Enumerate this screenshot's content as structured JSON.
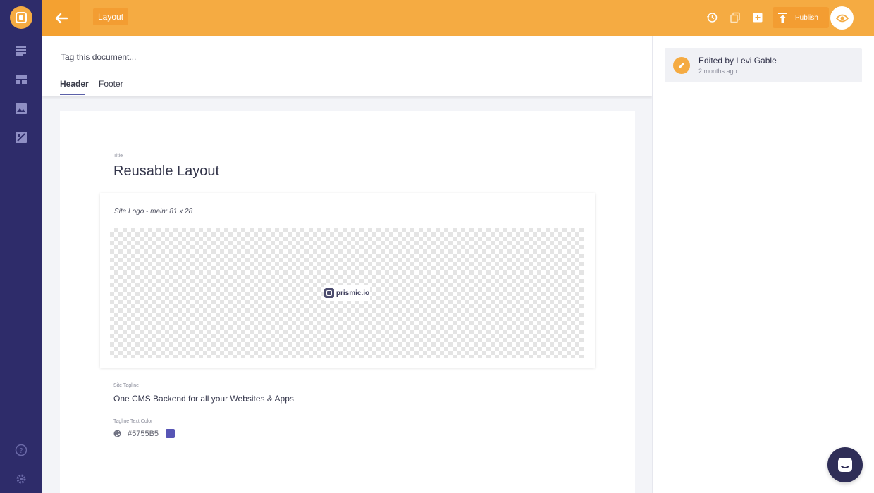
{
  "colors": {
    "accent": "#F5AB42",
    "sidebar": "#2E2C6A",
    "tagline_color_swatch": "#5755B5"
  },
  "sidebar": {
    "logo_icon": "prismic-repo-icon",
    "items": [
      {
        "icon": "documents-list-icon"
      },
      {
        "icon": "custom-types-icon"
      },
      {
        "icon": "media-library-icon"
      },
      {
        "icon": "slices-icon"
      }
    ],
    "bottom_items": [
      {
        "icon": "help-icon"
      },
      {
        "icon": "settings-gear-icon"
      }
    ]
  },
  "topbar": {
    "document_title": "Layout",
    "publish_label": "Publish"
  },
  "document": {
    "tag_placeholder": "Tag this document...",
    "tabs": [
      {
        "label": "Header",
        "active": true
      },
      {
        "label": "Footer",
        "active": false
      }
    ]
  },
  "history": {
    "title": "Edited by Levi Gable",
    "time": "2 months ago"
  },
  "editor": {
    "title_label": "Title",
    "title_value": "Reusable Layout",
    "image_caption": "Site Logo - main: 81 x 28",
    "image_logo_text": "prismic.io",
    "tagline_label": "Site Tagline",
    "tagline_value": "One CMS Backend for all your Websites & Apps",
    "color_label": "Tagline Text Color",
    "color_value": "#5755B5"
  }
}
